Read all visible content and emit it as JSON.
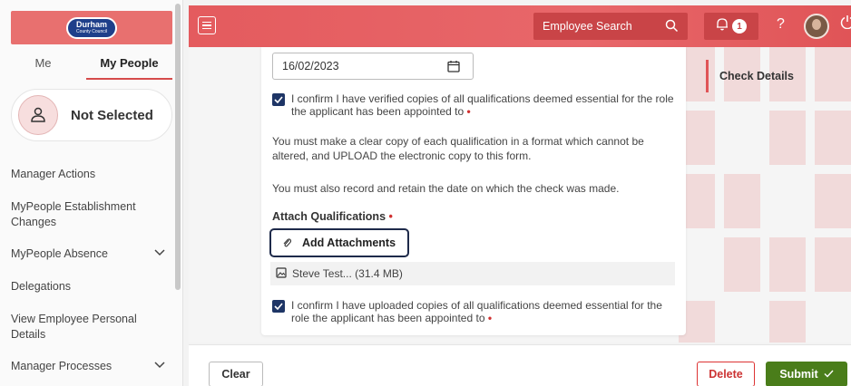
{
  "brand": {
    "logo_text": "Durham",
    "logo_subtext": "County Council",
    "accent": "#e5595c"
  },
  "sidebar": {
    "tabs": [
      {
        "label": "Me"
      },
      {
        "label": "My People"
      }
    ],
    "person": {
      "name": "Not Selected"
    },
    "nav": [
      {
        "label": "Manager Actions"
      },
      {
        "label": "MyPeople Establishment Changes"
      },
      {
        "label": "MyPeople Absence"
      },
      {
        "label": "Delegations"
      },
      {
        "label": "View Employee Personal Details"
      },
      {
        "label": "Manager Processes"
      }
    ]
  },
  "header": {
    "search_placeholder": "Employee Search",
    "notifications_count": "1",
    "help_label": "?"
  },
  "form": {
    "date_value": "16/02/2023",
    "confirm_verified": "I confirm I have verified copies of all qualifications deemed essential for the role the applicant has been appointed to",
    "para1": "You must make a clear copy of each qualification in a format which cannot be altered, and UPLOAD the electronic copy to this form.",
    "para2": "You must also record and retain the date on which the check was made.",
    "attach_label": "Attach Qualifications",
    "attach_button": "Add Attachments",
    "file_name": "Steve Test... (31.4 MB)",
    "confirm_uploaded": "I confirm I have uploaded copies of all qualifications deemed essential for the role the applicant has been appointed to"
  },
  "right_panel": {
    "check_details": "Check Details"
  },
  "footer": {
    "clear": "Clear",
    "delete": "Delete",
    "submit": "Submit"
  }
}
